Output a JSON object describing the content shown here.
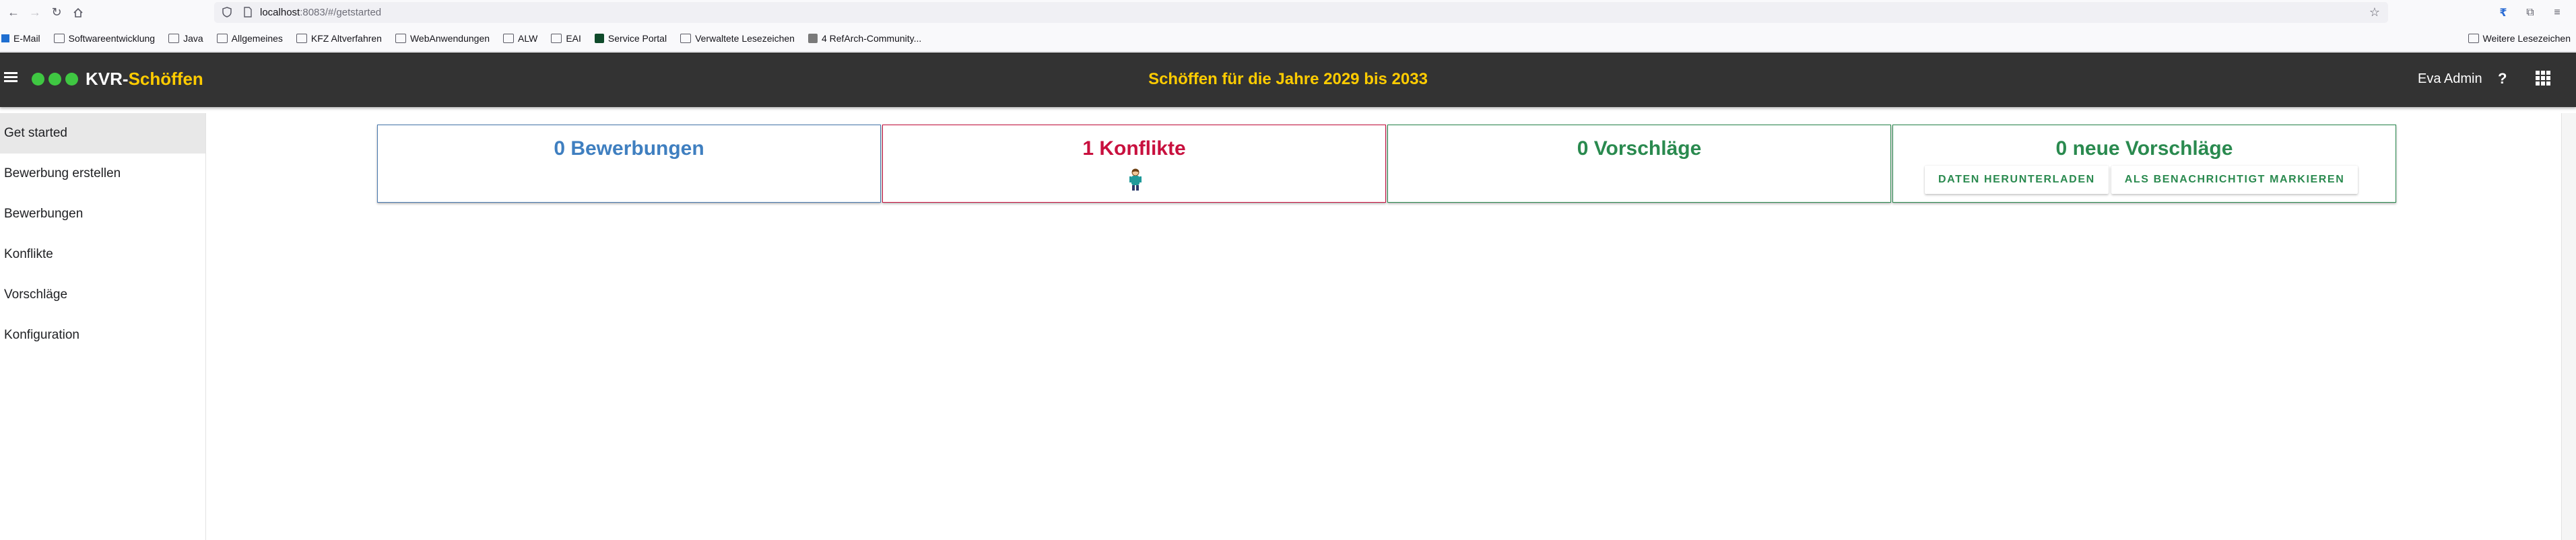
{
  "browser": {
    "url_host": "localhost",
    "url_rest": ":8083/#/getstarted",
    "bookmarks": [
      {
        "label": "E-Mail",
        "icon": "outlook-icon"
      },
      {
        "label": "Softwareentwicklung",
        "icon": "folder-icon"
      },
      {
        "label": "Java",
        "icon": "folder-icon"
      },
      {
        "label": "Allgemeines",
        "icon": "folder-icon"
      },
      {
        "label": "KFZ Altverfahren",
        "icon": "folder-icon"
      },
      {
        "label": "WebAnwendungen",
        "icon": "folder-icon"
      },
      {
        "label": "ALW",
        "icon": "folder-icon"
      },
      {
        "label": "EAI",
        "icon": "folder-icon"
      },
      {
        "label": "Service Portal",
        "icon": "service-portal-icon"
      },
      {
        "label": "Verwaltete Lesezeichen",
        "icon": "folder-icon"
      },
      {
        "label": "4 RefArch-Community...",
        "icon": "refarch-icon"
      }
    ],
    "other_bookmarks": "Weitere Lesezeichen"
  },
  "app": {
    "brand_part1": "KVR-",
    "brand_part2": "Schöffen",
    "title": "Schöffen für die Jahre 2029 bis 2033",
    "user": "Eva Admin",
    "help": "?"
  },
  "sidebar": {
    "items": [
      {
        "label": "Get started",
        "active": true
      },
      {
        "label": "Bewerbung erstellen"
      },
      {
        "label": "Bewerbungen"
      },
      {
        "label": "Konflikte"
      },
      {
        "label": "Vorschläge"
      },
      {
        "label": "Konfiguration"
      }
    ]
  },
  "cards": {
    "bewerbungen": "0 Bewerbungen",
    "konflikte": "1 Konflikte",
    "vorschlaege": "0 Vorschläge",
    "neue_vorschlaege": "0 neue Vorschläge",
    "download_label": "DATEN HERUNTERLADEN",
    "mark_label": "ALS BENACHRICHTIGT MARKIEREN"
  },
  "colors": {
    "appbar": "#333333",
    "accent_yellow": "#ffcc00",
    "status_green": "#3fc742",
    "blue": "#3f7fc0",
    "red": "#c8103e",
    "green": "#2a8a4f"
  }
}
